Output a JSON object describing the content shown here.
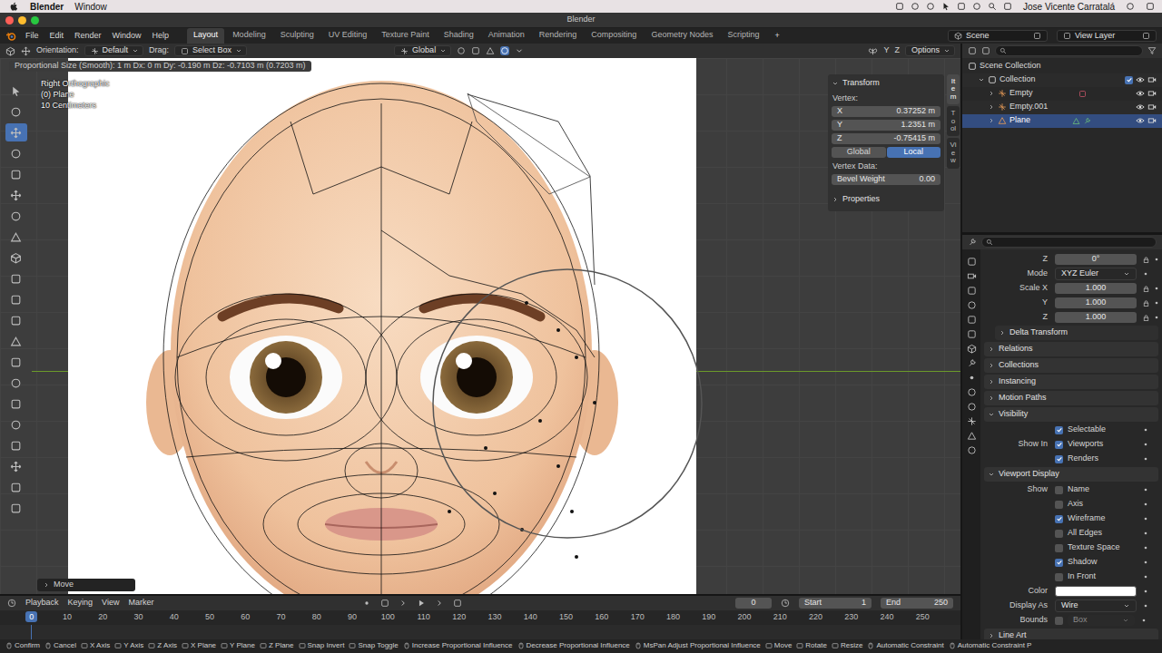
{
  "menubar": {
    "app": "Blender",
    "menus": [
      "Window"
    ],
    "user": "Jose Vicente Carratalá"
  },
  "window": {
    "title": "Blender"
  },
  "topbar": {
    "menus": [
      "File",
      "Edit",
      "Render",
      "Window",
      "Help"
    ],
    "workspaces": [
      {
        "label": "Layout",
        "selected": true
      },
      {
        "label": "Modeling",
        "selected": false
      },
      {
        "label": "Sculpting",
        "selected": false
      },
      {
        "label": "UV Editing",
        "selected": false
      },
      {
        "label": "Texture Paint",
        "selected": false
      },
      {
        "label": "Shading",
        "selected": false
      },
      {
        "label": "Animation",
        "selected": false
      },
      {
        "label": "Rendering",
        "selected": false
      },
      {
        "label": "Compositing",
        "selected": false
      },
      {
        "label": "Geometry Nodes",
        "selected": false
      },
      {
        "label": "Scripting",
        "selected": false
      }
    ],
    "add": "+",
    "scene": "Scene",
    "view_layer": "View Layer"
  },
  "header": {
    "orientation_label": "Orientation:",
    "orientation": "Default",
    "drag_label": "Drag:",
    "drag": "Select Box",
    "pivot": "Global",
    "proportional": true,
    "mirror": [
      "Y",
      "Z"
    ],
    "options": "Options"
  },
  "toolbar": {
    "tools": [
      {
        "selected": false
      },
      {
        "selected": false
      },
      {
        "selected": true
      },
      {
        "selected": false
      },
      {
        "selected": false
      },
      {
        "selected": false
      },
      {
        "selected": false
      },
      {
        "selected": false
      },
      {
        "selected": false
      },
      {
        "selected": false
      },
      {
        "selected": false
      },
      {
        "selected": false
      },
      {
        "selected": false
      },
      {
        "selected": false
      },
      {
        "selected": false
      },
      {
        "selected": false
      },
      {
        "selected": false
      },
      {
        "selected": false
      },
      {
        "selected": false
      },
      {
        "selected": false
      },
      {
        "selected": false
      }
    ]
  },
  "viewport": {
    "status": "Proportional Size (Smooth): 1 m  Dx: 0 m  Dy: -0.190 m  Dz: -0.7103 m (0.7203 m)",
    "view": "Right Orthographic",
    "object": "(0) Plane",
    "grid": "10 Centimeters",
    "operator": "Move"
  },
  "sidebar": {
    "section": "Transform",
    "vertex_label": "Vertex:",
    "fields": [
      {
        "label": "X",
        "value": "0.37252 m"
      },
      {
        "label": "Y",
        "value": "1.2351 m"
      },
      {
        "label": "Z",
        "value": "-0.75415 m"
      }
    ],
    "space": [
      {
        "label": "Global",
        "selected": false
      },
      {
        "label": "Local",
        "selected": true
      }
    ],
    "vertex_data": "Vertex Data:",
    "bevel": {
      "label": "Bevel Weight",
      "value": "0.00"
    },
    "properties": "Properties",
    "tabs": [
      {
        "label": "Item",
        "selected": true
      },
      {
        "label": "Tool",
        "selected": false
      },
      {
        "label": "View",
        "selected": false
      }
    ]
  },
  "outliner": {
    "items": [
      {
        "label": "Scene Collection",
        "kind": "scene",
        "depth": 0,
        "selected": false
      },
      {
        "label": "Collection",
        "kind": "collection",
        "depth": 1,
        "expanded": true,
        "checked": true,
        "visible": true,
        "renderable": true,
        "selected": false
      },
      {
        "label": "Empty",
        "kind": "empty",
        "depth": 2,
        "expanded": false,
        "visible": true,
        "renderable": true,
        "selected": false
      },
      {
        "label": "Empty.001",
        "kind": "empty-plain",
        "depth": 2,
        "expanded": false,
        "visible": true,
        "renderable": true,
        "selected": false
      },
      {
        "label": "Plane",
        "kind": "mesh",
        "depth": 2,
        "expanded": false,
        "visible": true,
        "renderable": true,
        "selected": true
      }
    ]
  },
  "properties": {
    "rows": [
      {
        "kind": "field",
        "label": "Z",
        "value": "0°"
      },
      {
        "kind": "select",
        "label": "Mode",
        "value": "XYZ Euler"
      },
      {
        "kind": "field",
        "label": "Scale X",
        "value": "1.000"
      },
      {
        "kind": "field",
        "label": "Y",
        "value": "1.000"
      },
      {
        "kind": "field",
        "label": "Z",
        "value": "1.000"
      },
      {
        "kind": "subsection",
        "label": "Delta Transform",
        "expanded": false
      },
      {
        "kind": "section",
        "label": "Relations",
        "expanded": false
      },
      {
        "kind": "section",
        "label": "Collections",
        "expanded": false
      },
      {
        "kind": "section",
        "label": "Instancing",
        "expanded": false
      },
      {
        "kind": "section",
        "label": "Motion Paths",
        "expanded": false
      },
      {
        "kind": "section",
        "label": "Visibility",
        "expanded": true
      },
      {
        "kind": "check",
        "text": "Selectable",
        "checked": true
      },
      {
        "kind": "check",
        "label": "Show In",
        "text": "Viewports",
        "checked": true
      },
      {
        "kind": "check",
        "text": "Renders",
        "checked": true
      },
      {
        "kind": "section",
        "label": "Viewport Display",
        "expanded": true
      },
      {
        "kind": "check",
        "label": "Show",
        "text": "Name",
        "checked": false
      },
      {
        "kind": "check",
        "text": "Axis",
        "checked": false
      },
      {
        "kind": "check",
        "text": "Wireframe",
        "checked": true
      },
      {
        "kind": "check",
        "text": "All Edges",
        "checked": false
      },
      {
        "kind": "check",
        "text": "Texture Space",
        "checked": false
      },
      {
        "kind": "check",
        "text": "Shadow",
        "checked": true
      },
      {
        "kind": "check",
        "text": "In Front",
        "checked": false
      },
      {
        "kind": "color",
        "label": "Color",
        "color": "#ffffff"
      },
      {
        "kind": "select",
        "label": "Display As",
        "value": "Wire"
      },
      {
        "kind": "check-select",
        "label": "Bounds",
        "checked": false,
        "value": "Box"
      },
      {
        "kind": "section",
        "label": "Line Art",
        "expanded": false
      }
    ]
  },
  "timeline": {
    "menus": [
      "Playback",
      "Keying",
      "View",
      "Marker"
    ],
    "frame": "0",
    "start_label": "Start",
    "start": "1",
    "end_label": "End",
    "end": "250",
    "current": "0",
    "ticks": [
      "10",
      "20",
      "30",
      "40",
      "50",
      "60",
      "70",
      "80",
      "90",
      "100",
      "110",
      "120",
      "130",
      "140",
      "150",
      "160",
      "170",
      "180",
      "190",
      "200",
      "210",
      "220",
      "230",
      "240",
      "250"
    ]
  },
  "status_bar": {
    "items": [
      "Confirm",
      "Cancel",
      "X Axis",
      "Y Axis",
      "Z Axis",
      "X Plane",
      "Y Plane",
      "Z Plane",
      "Snap Invert",
      "Snap Toggle",
      "Increase Proportional Influence",
      "Decrease Proportional Influence",
      "MsPan Adjust Proportional Influence",
      "Move",
      "Rotate",
      "Resize",
      "Automatic Constraint",
      "Automatic Constraint P"
    ]
  }
}
